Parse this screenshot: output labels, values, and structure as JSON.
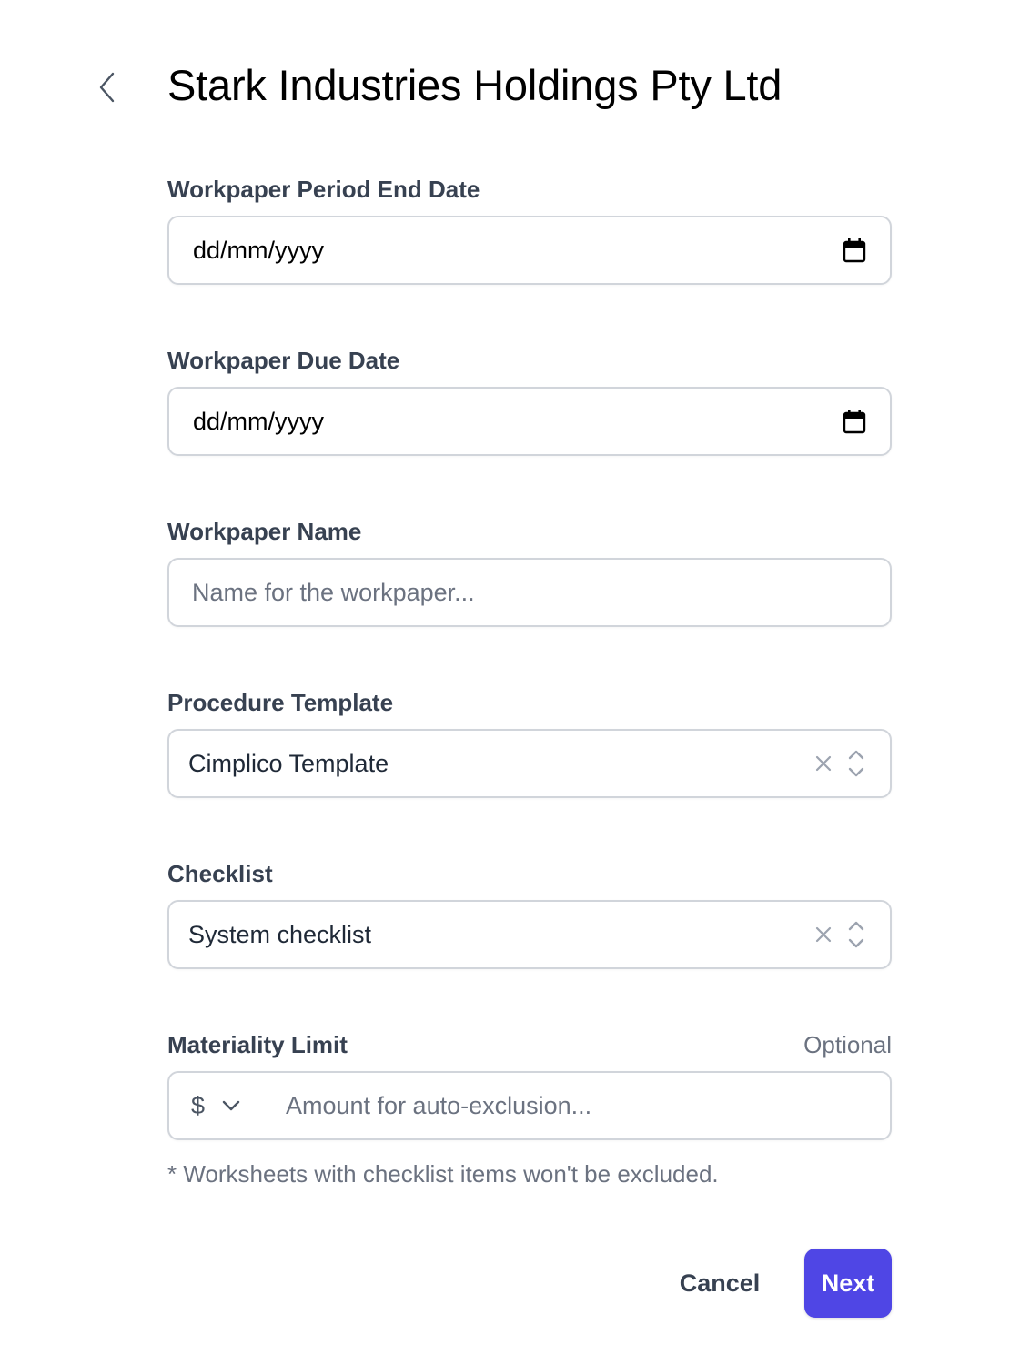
{
  "header": {
    "back_icon": "chevron-left-icon",
    "title": "Stark Industries Holdings Pty Ltd"
  },
  "form": {
    "period_end_date": {
      "label": "Workpaper Period End Date",
      "value": "dd/mm/yyyy",
      "icon": "calendar-icon"
    },
    "due_date": {
      "label": "Workpaper Due Date",
      "value": "dd/mm/yyyy",
      "icon": "calendar-icon"
    },
    "workpaper_name": {
      "label": "Workpaper Name",
      "value": "",
      "placeholder": "Name for the workpaper..."
    },
    "procedure_template": {
      "label": "Procedure Template",
      "selected": "Cimplico Template",
      "clear_icon": "close-icon",
      "toggle_icon": "chevron-up-down-icon"
    },
    "checklist": {
      "label": "Checklist",
      "selected": "System checklist",
      "clear_icon": "close-icon",
      "toggle_icon": "chevron-up-down-icon"
    },
    "materiality_limit": {
      "label": "Materiality Limit",
      "optional_label": "Optional",
      "currency": "$",
      "currency_icon": "chevron-down-icon",
      "value": "",
      "placeholder": "Amount for auto-exclusion...",
      "hint": "* Worksheets with checklist items won't be excluded."
    }
  },
  "actions": {
    "cancel_label": "Cancel",
    "next_label": "Next"
  },
  "colors": {
    "primary": "#4f46e5",
    "label": "#374151",
    "muted": "#6b7280",
    "border": "#d1d5db"
  }
}
